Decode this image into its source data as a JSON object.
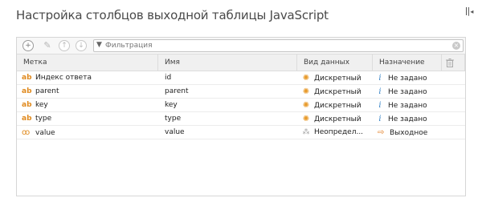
{
  "title": "Настройка столбцов выходной таблицы JavaScript",
  "toolbar": {
    "add_glyph": "+",
    "edit_glyph": "✎",
    "up_glyph": "↑",
    "down_glyph": "↓",
    "filter_glyph": "▼",
    "clear_glyph": "×",
    "filter_placeholder": "Фильтрация",
    "filter_value": ""
  },
  "table": {
    "headers": {
      "label": "Метка",
      "name": "Имя",
      "data_type": "Вид данных",
      "purpose": "Назначение"
    },
    "rows": [
      {
        "kind_glyph": "ab",
        "label": "Индекс ответа",
        "name": "id",
        "data_type": "Дискретный",
        "type_icon": "gear-icon",
        "type_glyph": "✺",
        "purpose": "Не задано",
        "purpose_icon": "info-icon",
        "purpose_glyph": "i"
      },
      {
        "kind_glyph": "ab",
        "label": "parent",
        "name": "parent",
        "data_type": "Дискретный",
        "type_icon": "gear-icon",
        "type_glyph": "✺",
        "purpose": "Не задано",
        "purpose_icon": "info-icon",
        "purpose_glyph": "i"
      },
      {
        "kind_glyph": "ab",
        "label": "key",
        "name": "key",
        "data_type": "Дискретный",
        "type_icon": "gear-icon",
        "type_glyph": "✺",
        "purpose": "Не задано",
        "purpose_icon": "info-icon",
        "purpose_glyph": "i"
      },
      {
        "kind_glyph": "ab",
        "label": "type",
        "name": "type",
        "data_type": "Дискретный",
        "type_icon": "gear-icon",
        "type_glyph": "✺",
        "purpose": "Не задано",
        "purpose_icon": "info-icon",
        "purpose_glyph": "i"
      },
      {
        "kind_glyph": "oo",
        "label": "value",
        "name": "value",
        "data_type": "Неопредел...",
        "type_icon": "unknown-type-icon",
        "type_glyph": "⁂",
        "purpose": "Выходное",
        "purpose_icon": "output-arrow-icon",
        "purpose_glyph": "⇨"
      }
    ]
  },
  "colors": {
    "accent_orange": "#e08a1e",
    "info_blue": "#3b86c8"
  }
}
